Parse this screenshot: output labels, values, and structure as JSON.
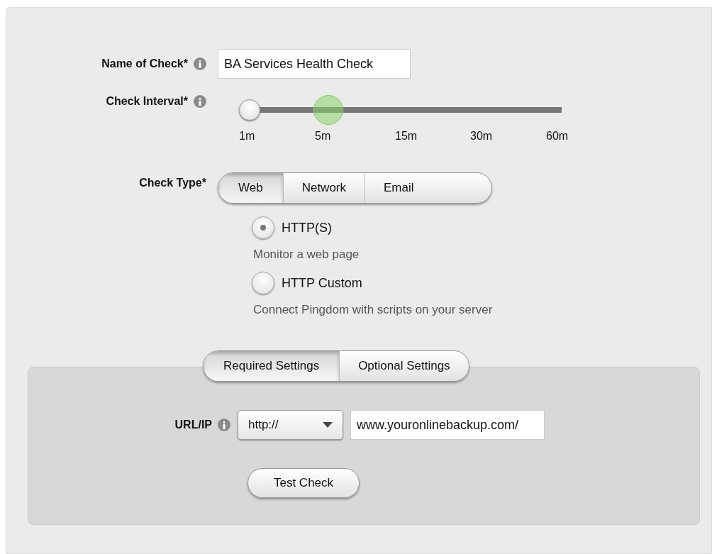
{
  "name_field": {
    "label": "Name of Check*",
    "value": "BA Services Health Check"
  },
  "interval": {
    "label": "Check Interval*",
    "level": 0,
    "ticks": [
      "1m",
      "5m",
      "15m",
      "30m",
      "60m"
    ]
  },
  "check_type": {
    "label": "Check Type*",
    "tabs": [
      {
        "label": "Web",
        "selected": true
      },
      {
        "label": "Network",
        "selected": false
      },
      {
        "label": "Email",
        "selected": false
      }
    ],
    "options": [
      {
        "label": "HTTP(S)",
        "description": "Monitor a web page",
        "selected": true
      },
      {
        "label": "HTTP Custom",
        "description": "Connect Pingdom with scripts on your server",
        "selected": false
      }
    ]
  },
  "settings_tabs": [
    {
      "label": "Required Settings",
      "selected": true
    },
    {
      "label": "Optional Settings",
      "selected": false
    }
  ],
  "url": {
    "label": "URL/IP",
    "protocol": "http://",
    "value": "www.youronlinebackup.com/"
  },
  "test_button": "Test Check"
}
